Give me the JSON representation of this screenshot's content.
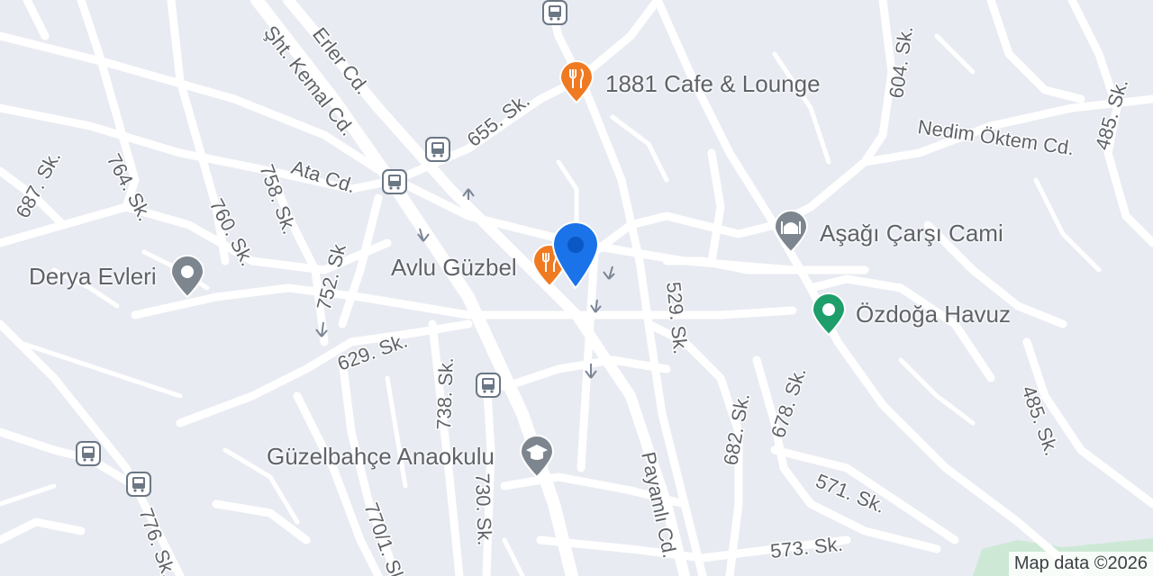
{
  "map": {
    "attribution": "Map data ©2026",
    "colors": {
      "background": "#e8ebf2",
      "road": "#ffffff",
      "label": "#5f6368",
      "food": "#f07a22",
      "poi_gray": "#7d868f",
      "park": "#1e9e6a",
      "user": "#1a73e8",
      "park_area": "#cde9d6"
    },
    "streets": {
      "erler": "Erler Cd.",
      "sht_kemal": "Şht. Kemal Cd.",
      "ata": "Ata Cd.",
      "s655": "655. Sk.",
      "s687": "687. Sk.",
      "s764": "764. Sk.",
      "s760": "760. Sk.",
      "s758": "758. Sk.",
      "s752": "752. Sk",
      "s629": "629. Sk.",
      "s738": "738. Sk.",
      "s730": "730. Sk.",
      "s770": "770/1. Sk",
      "s776": "776. Sk.",
      "payamli": "Payamlı Cd.",
      "s529": "529. Sk.",
      "s682": "682. Sk.",
      "s678": "678. Sk.",
      "s571": "571. Sk.",
      "s573": "573. Sk.",
      "s485a": "485. Sk.",
      "s485b": "485. Sk.",
      "s604": "604. Sk.",
      "nedim": "Nedim Öktem Cd."
    },
    "pois": {
      "cafe": {
        "name": "1881 Cafe & Lounge",
        "icon": "restaurant-icon"
      },
      "avlu": {
        "name": "Avlu Güzbel",
        "icon": "restaurant-icon"
      },
      "mosque": {
        "name": "Aşağı Çarşı Cami",
        "icon": "mosque-icon"
      },
      "havuz": {
        "name": "Özdoğa Havuz",
        "icon": "park-icon"
      },
      "derya": {
        "name": "Derya Evleri",
        "icon": "place-icon"
      },
      "anaokulu": {
        "name": "Güzelbahçe Anaokulu",
        "icon": "school-icon"
      }
    },
    "bus_stop_icon": "bus-icon",
    "user_location_icon": "location-pin-icon"
  }
}
